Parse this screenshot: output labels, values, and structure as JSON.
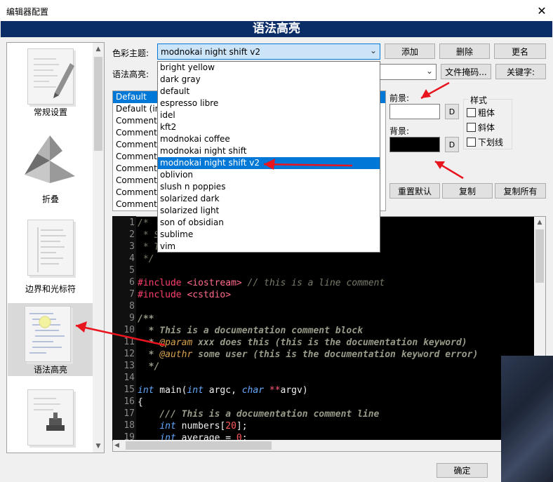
{
  "window": {
    "title": "编辑器配置",
    "close_glyph": "✕"
  },
  "header": {
    "title": "语法高亮"
  },
  "sidebar": {
    "items": [
      {
        "label": "常规设置"
      },
      {
        "label": "折叠"
      },
      {
        "label": "边界和光标符"
      },
      {
        "label": "语法高亮"
      }
    ]
  },
  "theme": {
    "label": "色彩主题:",
    "selected": "modnokai night shift v2",
    "options": [
      "bright yellow",
      "dark gray",
      "default",
      "espresso libre",
      "idel",
      "kft2",
      "modnokai coffee",
      "modnokai night shift",
      "modnokai night shift v2",
      "oblivion",
      "slush n poppies",
      "solarized dark",
      "solarized light",
      "son of obsidian",
      "sublime",
      "vim"
    ],
    "add_label": "添加",
    "delete_label": "删除",
    "rename_label": "更名"
  },
  "syntax": {
    "label": "语法高亮:",
    "value": "",
    "file_mask_label": "文件掩码...",
    "keywords_label": "关键字:"
  },
  "styles": {
    "items": [
      "Default",
      "Default (in",
      "Comment",
      "Comment",
      "Comment",
      "Comment",
      "Comment",
      "Comment",
      "Comment",
      "Comment"
    ]
  },
  "colors": {
    "fg_label": "前景:",
    "bg_label": "背景:",
    "fg_color": "#ffffff",
    "bg_color": "#000000",
    "d_label": "D"
  },
  "font_style": {
    "title": "样式",
    "bold": "粗体",
    "italic": "斜体",
    "underline": "下划线"
  },
  "actions": {
    "reset": "重置默认",
    "copy": "复制",
    "copy_all": "复制所有"
  },
  "editor": {
    "lines": [
      {
        "n": "1"
      },
      {
        "n": "2"
      },
      {
        "n": "3"
      },
      {
        "n": "4"
      },
      {
        "n": "5"
      },
      {
        "n": "6"
      },
      {
        "n": "7"
      },
      {
        "n": "8"
      },
      {
        "n": "9"
      },
      {
        "n": "10"
      },
      {
        "n": "11"
      },
      {
        "n": "12"
      },
      {
        "n": "13"
      },
      {
        "n": "14"
      },
      {
        "n": "15"
      },
      {
        "n": "16"
      },
      {
        "n": "17"
      },
      {
        "n": "18"
      },
      {
        "n": "19"
      }
    ],
    "code": {
      "l1": "/*",
      "l2": " * S",
      "l3": " * T",
      "l4": " */",
      "l6a": "#include ",
      "l6b": "<iostream>",
      "l6c": " // this is a line comment",
      "l7a": "#include ",
      "l7b": "<cstdio>",
      "l9": "/**",
      "l10": "  * This is a documentation comment block",
      "l11a": "  * ",
      "l11b": "@param",
      "l11c": " xxx does this (this is the documentation keyword)",
      "l12a": "  * ",
      "l12b": "@authr",
      "l12c": " some user (this is the documentation keyword error)",
      "l13": "  */",
      "l15a": "int",
      "l15b": " main(",
      "l15c": "int",
      "l15d": " argc, ",
      "l15e": "char",
      "l15f": " **",
      "l15g": "argv)",
      "l16": "{",
      "l17": "    /// This is a documentation comment line",
      "l18a": "    ",
      "l18b": "int",
      "l18c": " numbers[",
      "l18d": "20",
      "l18e": "];",
      "l19a": "    ",
      "l19b": "int",
      "l19c": " average = ",
      "l19d": "0",
      "l19e": ";"
    }
  },
  "footer": {
    "ok_label": "确定"
  }
}
